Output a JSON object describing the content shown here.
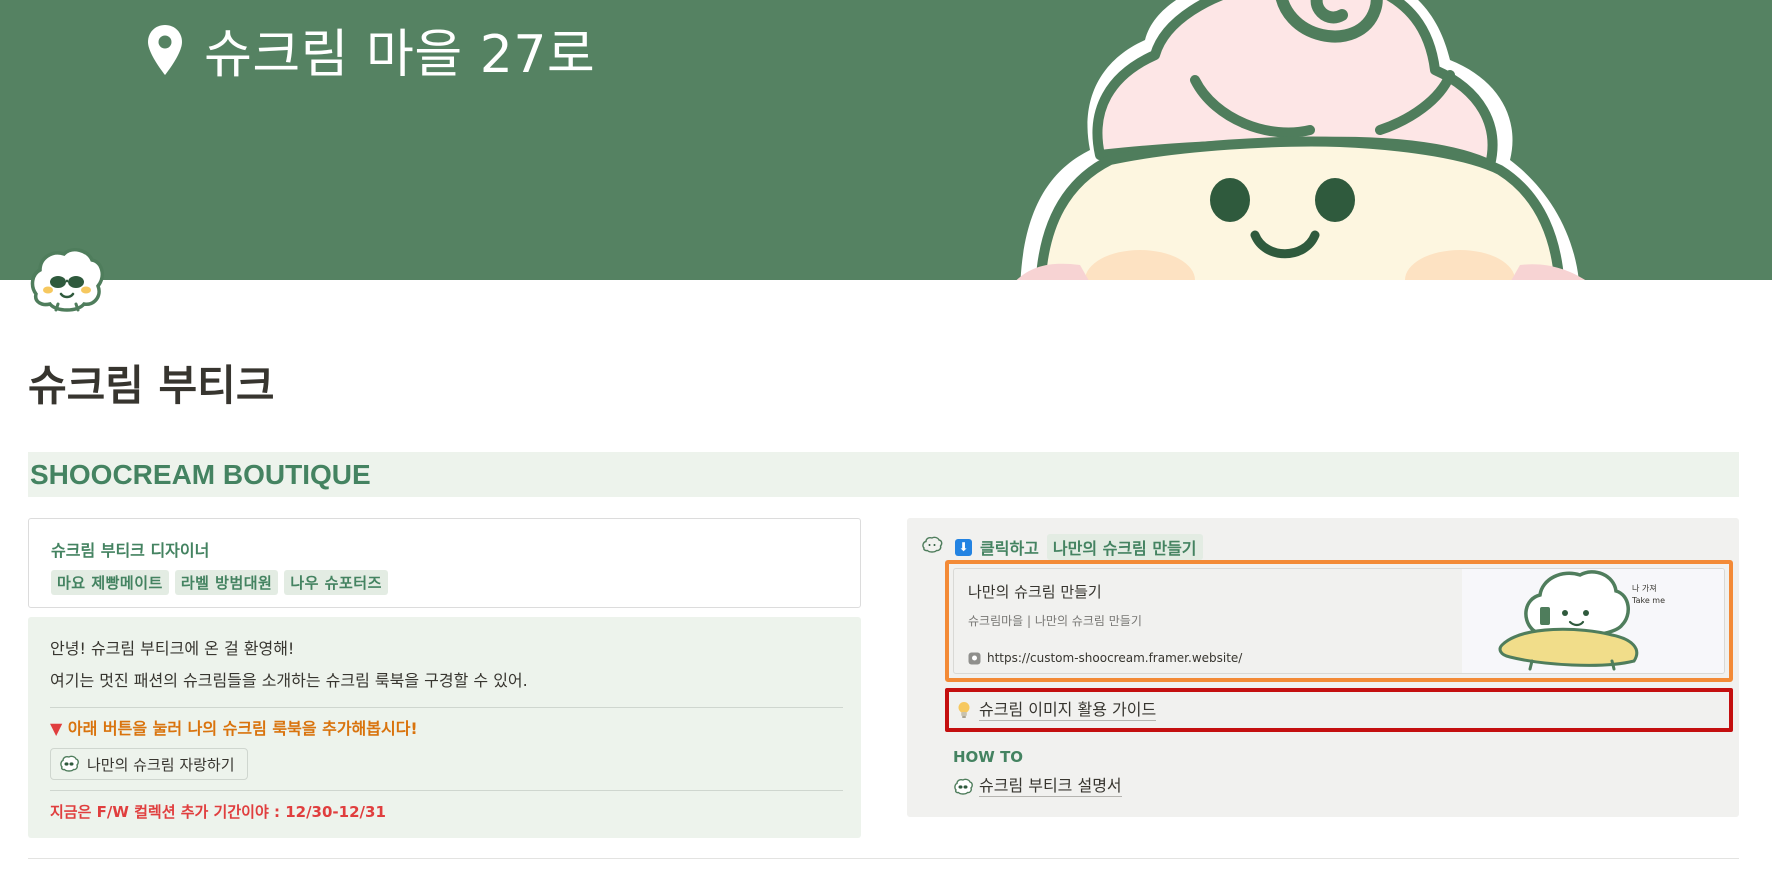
{
  "cover": {
    "location_text": "슈크림 마을 27로",
    "location_icon": "map-pin-icon",
    "background": "#558262"
  },
  "page": {
    "title": "슈크림 부티크",
    "icon": "shoocream-sunglasses-icon"
  },
  "banner": {
    "heading": "SHOOCREAM BOUTIQUE"
  },
  "designer": {
    "title": "슈크림 부티크 디자이너",
    "tags": [
      "마요 제빵메이트",
      "라벨 방범대원",
      "나우 슈포터즈"
    ]
  },
  "welcome": {
    "line1": "안녕! 슈크림 부티크에 온 걸 환영해!",
    "line2": "여기는 멋진 패션의 슈크림들을 소개하는 슈크림 룩북을 구경할 수 있어.",
    "cta_arrow": "▼",
    "cta": "아래 버튼을 눌러 나의 슈크림 룩북을 추가해봅시다!",
    "button_label": "나만의 슈크림 자랑하기",
    "notice": "지금은 F/W 컬렉션 추가 기간이야 : 12/30-12/31"
  },
  "right": {
    "click_prefix": "클릭하고",
    "click_highlight": "나만의 슈크림 만들기",
    "bookmark": {
      "title": "나만의 슈크림 만들기",
      "description": "슈크림마을 | 나만의 슈크림 만들기",
      "url": "https://custom-shoocream.framer.website/",
      "thumb_text_1": "나 가져",
      "thumb_text_2": "Take me"
    },
    "guide_label": "슈크림 이미지 활용 가이드",
    "howto_heading": "HOW TO",
    "manual_label": "슈크림 부티크 설명서"
  },
  "colors": {
    "accent_green": "#448361",
    "highlight_bg": "#e3ece3",
    "orange": "#d9730d",
    "red": "#e03e3e",
    "frame_orange": "#f38a36",
    "frame_red": "#c40f0f"
  }
}
